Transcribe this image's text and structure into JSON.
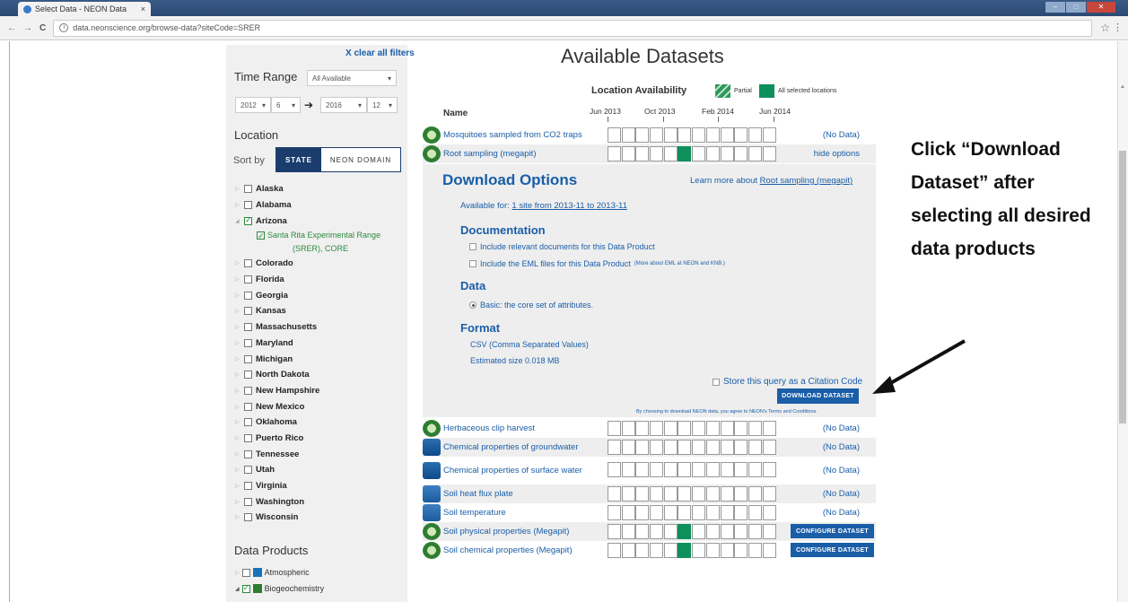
{
  "browser": {
    "tab_title": "Select Data - NEON Data",
    "tab_close": "×",
    "url": "data.neonscience.org/browse-data?siteCode=SRER",
    "star": "☆",
    "menu": "⋮",
    "back": "←",
    "forward": "→",
    "reload": "C",
    "info": "i"
  },
  "sidebar": {
    "clear_filters": "X clear all filters",
    "time_range_title": "Time Range",
    "time_range_select": "All Available",
    "start_year": "2012",
    "start_month": "6",
    "end_year": "2016",
    "end_month": "12",
    "range_arrow": "➔",
    "location_title": "Location",
    "sort_by": "Sort by",
    "sort_state": "STATE",
    "sort_domain": "NEON DOMAIN",
    "states": [
      {
        "label": "Alaska",
        "checked": false,
        "expanded": false
      },
      {
        "label": "Alabama",
        "checked": false,
        "expanded": false
      },
      {
        "label": "Arizona",
        "checked": true,
        "expanded": true
      },
      {
        "label": "Colorado",
        "checked": false,
        "expanded": false
      },
      {
        "label": "Florida",
        "checked": false,
        "expanded": false
      },
      {
        "label": "Georgia",
        "checked": false,
        "expanded": false
      },
      {
        "label": "Kansas",
        "checked": false,
        "expanded": false
      },
      {
        "label": "Massachusetts",
        "checked": false,
        "expanded": false
      },
      {
        "label": "Maryland",
        "checked": false,
        "expanded": false
      },
      {
        "label": "Michigan",
        "checked": false,
        "expanded": false
      },
      {
        "label": "North Dakota",
        "checked": false,
        "expanded": false
      },
      {
        "label": "New Hampshire",
        "checked": false,
        "expanded": false
      },
      {
        "label": "New Mexico",
        "checked": false,
        "expanded": false
      },
      {
        "label": "Oklahoma",
        "checked": false,
        "expanded": false
      },
      {
        "label": "Puerto Rico",
        "checked": false,
        "expanded": false
      },
      {
        "label": "Tennessee",
        "checked": false,
        "expanded": false
      },
      {
        "label": "Utah",
        "checked": false,
        "expanded": false
      },
      {
        "label": "Virginia",
        "checked": false,
        "expanded": false
      },
      {
        "label": "Washington",
        "checked": false,
        "expanded": false
      },
      {
        "label": "Wisconsin",
        "checked": false,
        "expanded": false
      }
    ],
    "site_line1": "Santa Rita Experimental Range",
    "site_line2": "(SRER), CORE",
    "data_products_title": "Data Products",
    "dp_atmospheric": "Atmospheric",
    "dp_biogeochemistry": "Biogeochemistry"
  },
  "main": {
    "title": "Available Datasets",
    "location_availability": "Location Availability",
    "legend_partial": "Partial",
    "legend_all": "All selected locations",
    "col_name": "Name",
    "dates": [
      "Jun 2013",
      "Oct 2013",
      "Feb 2014",
      "Jun 2014"
    ],
    "rows_top": [
      {
        "name": "Mosquitoes sampled from CO2 traps",
        "icon": "bio",
        "status": "(No Data)",
        "filled": []
      },
      {
        "name": "Root sampling (megapit)",
        "icon": "bio",
        "status": "hide options",
        "filled": [
          5
        ]
      }
    ],
    "rows_bottom": [
      {
        "name": "Herbaceous clip harvest",
        "icon": "bio",
        "status": "(No Data)",
        "filled": [],
        "config": false
      },
      {
        "name": "Chemical properties of groundwater",
        "icon": "aqua",
        "status": "(No Data)",
        "filled": [],
        "config": false
      },
      {
        "name": "Chemical properties of surface water",
        "icon": "aqua",
        "status": "(No Data)",
        "filled": [],
        "config": false
      },
      {
        "name": "Soil heat flux plate",
        "icon": "soil",
        "status": "(No Data)",
        "filled": [],
        "config": false
      },
      {
        "name": "Soil temperature",
        "icon": "soil",
        "status": "(No Data)",
        "filled": [],
        "config": false
      },
      {
        "name": "Soil physical properties (Megapit)",
        "icon": "bio",
        "status": "",
        "filled": [
          5
        ],
        "config": true
      },
      {
        "name": "Soil chemical properties (Megapit)",
        "icon": "bio",
        "status": "",
        "filled": [
          5
        ],
        "config": true
      }
    ],
    "config_label": "CONFIGURE DATASET"
  },
  "download": {
    "title": "Download Options",
    "learn_more_prefix": "Learn more about ",
    "learn_more_link": "Root sampling (megapit)",
    "available_prefix": "Available for: ",
    "available_link": "1 site from 2013-11 to 2013-11",
    "documentation": "Documentation",
    "include_docs": "Include relevant documents for this Data Product",
    "include_eml": "Include the EML files for this Data Product",
    "include_eml_small": "(More about EML at NEON and KNB.)",
    "data": "Data",
    "basic": "Basic: the core set of attributes.",
    "format": "Format",
    "csv": "CSV (Comma Separated Values)",
    "size": "Estimated size 0.018 MB",
    "store_query": "Store this query as a Citation Code",
    "download_button": "DOWNLOAD DATASET",
    "terms": "By choosing to download NEON data, you agree to NEON's Terms and Conditions."
  },
  "annotation": {
    "text": "Click “Download Dataset” after selecting all desired data products"
  }
}
